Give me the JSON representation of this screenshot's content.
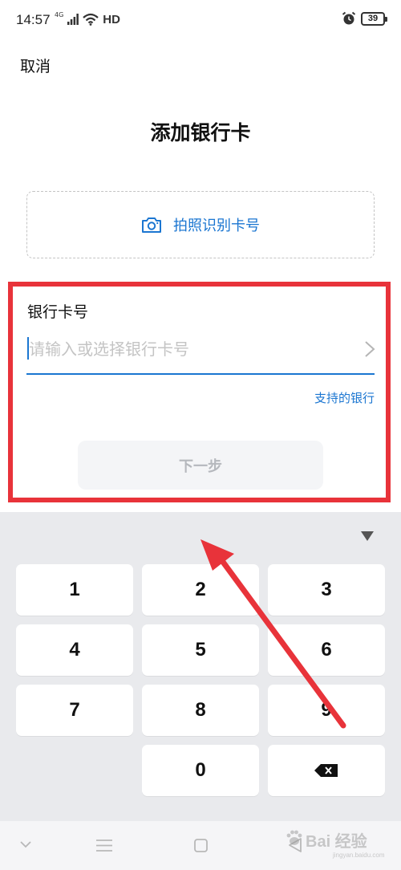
{
  "status_bar": {
    "time": "14:57",
    "network": "4G",
    "hd": "HD",
    "battery": "39"
  },
  "header": {
    "cancel": "取消",
    "title": "添加银行卡"
  },
  "scan": {
    "label": "拍照识别卡号",
    "icon": "camera-icon"
  },
  "form": {
    "field_label": "银行卡号",
    "card_placeholder": "请输入或选择银行卡号",
    "card_value": "",
    "supported_banks": "支持的银行",
    "next_label": "下一步"
  },
  "keyboard": {
    "keys": [
      "1",
      "2",
      "3",
      "4",
      "5",
      "6",
      "7",
      "8",
      "9",
      "0"
    ],
    "collapse_icon": "triangle-down-icon",
    "delete_icon": "backspace-icon"
  },
  "nav": {
    "icons": [
      "chevron-down-icon",
      "menu-icon",
      "home-square-icon",
      "back-triangle-icon"
    ]
  },
  "watermark": {
    "brand": "Bai  经验",
    "sub": "jingyan.baidu.com"
  },
  "colors": {
    "accent": "#1b76d1",
    "annotation": "#e8333a",
    "keyboard_bg": "#e9eaed",
    "disabled_button_bg": "#f4f5f7",
    "placeholder": "#c4c4c4"
  }
}
